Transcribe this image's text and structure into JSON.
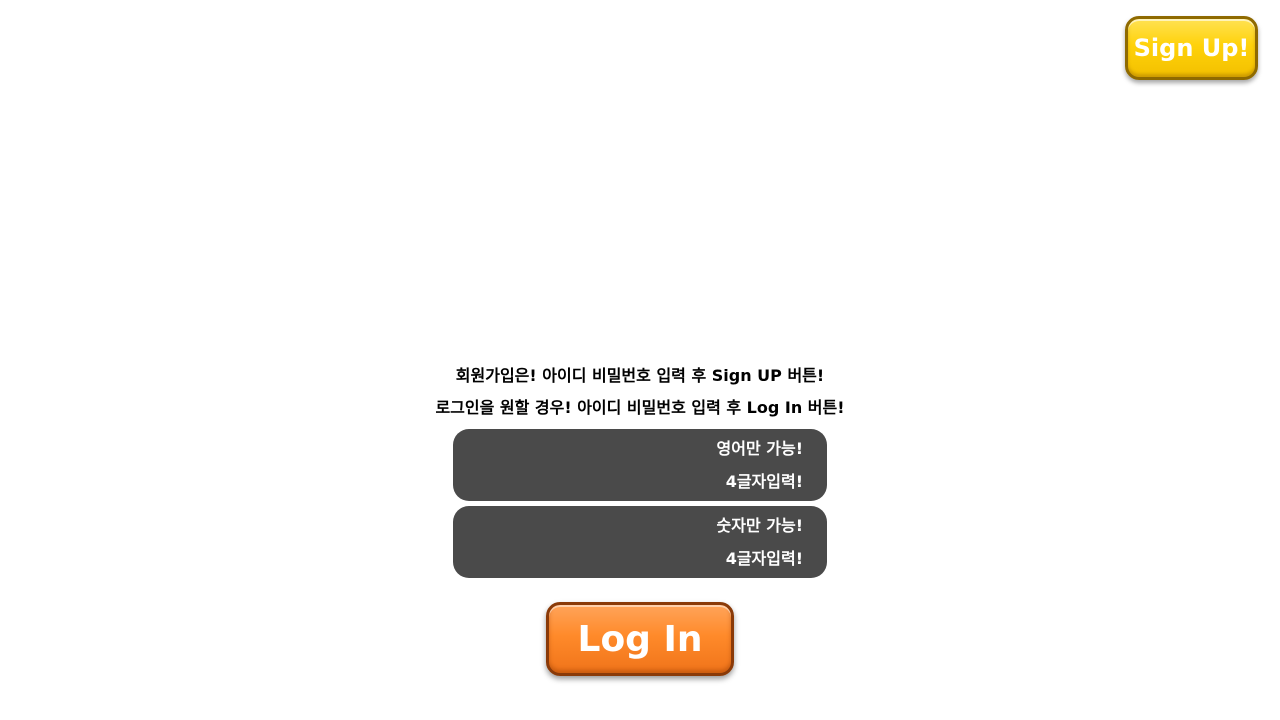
{
  "header": {
    "signup_label": "Sign Up!"
  },
  "instructions": {
    "line1": "회원가입은! 아이디 비밀번호 입력 후 Sign UP 버튼!",
    "line2": "로그인을 원할 경우! 아이디 비밀번호 입력 후 Log In 버튼!"
  },
  "id_field": {
    "value": "",
    "placeholder": "",
    "hint_line1": "영어만 가능!",
    "hint_line2": "4글자입력!"
  },
  "password_field": {
    "value": "",
    "placeholder": "",
    "hint_line1": "숫자만 가능!",
    "hint_line2": "4글자입력!"
  },
  "login": {
    "label": "Log In"
  },
  "colors": {
    "signup_button": "#ffd20a",
    "login_button": "#ff8a2a",
    "field_background": "#4a4a4a"
  }
}
